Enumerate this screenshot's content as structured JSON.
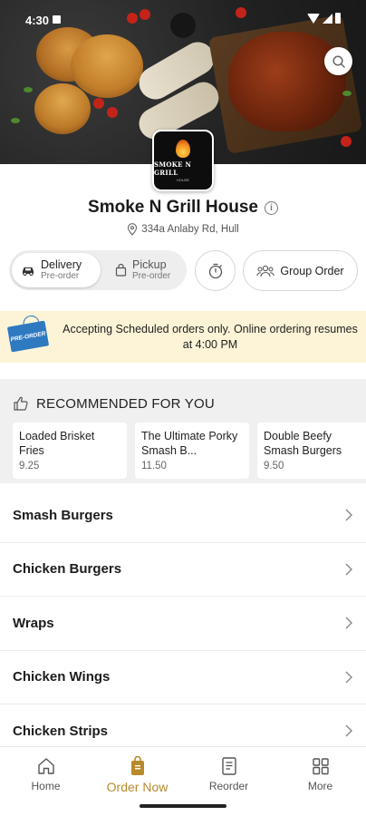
{
  "status_bar": {
    "time": "4:30"
  },
  "restaurant": {
    "logo_text": "SMOKE N GRILL",
    "logo_subtext": "HOUSE",
    "name": "Smoke N Grill House",
    "address": "334a Anlaby Rd, Hull"
  },
  "order_modes": [
    {
      "label": "Delivery",
      "sub": "Pre-order",
      "active": true
    },
    {
      "label": "Pickup",
      "sub": "Pre-order",
      "active": false
    }
  ],
  "group_order_label": "Group Order",
  "notice": {
    "tag": "PRE-ORDER",
    "text": "Accepting Scheduled orders only. Online ordering resumes at 4:00 PM"
  },
  "recommended": {
    "title": "RECOMMENDED FOR YOU",
    "items": [
      {
        "name": "Loaded Brisket Fries",
        "price": "9.25"
      },
      {
        "name": "The Ultimate Porky Smash B...",
        "price": "11.50"
      },
      {
        "name": "Double Beefy Smash Burgers",
        "price": "9.50"
      }
    ]
  },
  "categories": [
    {
      "label": "Smash Burgers"
    },
    {
      "label": "Chicken Burgers"
    },
    {
      "label": "Wraps"
    },
    {
      "label": "Chicken Wings"
    },
    {
      "label": "Chicken Strips"
    }
  ],
  "bottom_nav": [
    {
      "label": "Home",
      "icon": "home-icon"
    },
    {
      "label": "Order Now",
      "icon": "order-bag-icon",
      "active": true
    },
    {
      "label": "Reorder",
      "icon": "receipt-icon"
    },
    {
      "label": "More",
      "icon": "grid-icon"
    }
  ],
  "colors": {
    "accent": "#b88a2c",
    "notice_bg": "#fdf4d8",
    "tag_blue": "#2f79c1"
  }
}
